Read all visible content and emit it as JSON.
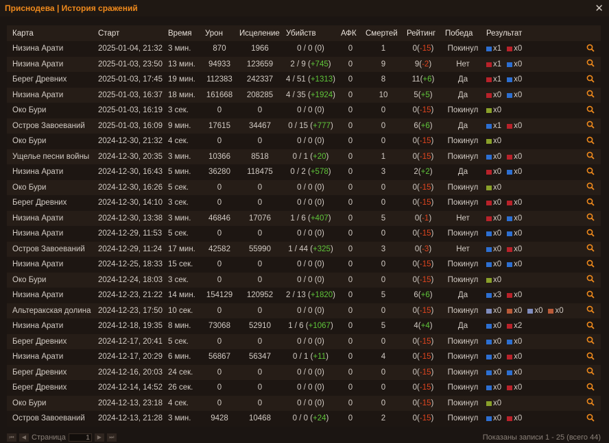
{
  "window": {
    "title": "Приснодева | История сражений"
  },
  "columns": [
    "Карта",
    "Старт",
    "Время",
    "Урон",
    "Исцеление",
    "Убийств",
    "АФК",
    "Смертей",
    "Рейтинг",
    "Победа",
    "Результат"
  ],
  "rows": [
    {
      "map": "Низина Арати",
      "start": "2025-01-04, 21:32",
      "time": "3 мин.",
      "damage": "870",
      "heal": "1966",
      "kills": "0 / 0",
      "kills_delta": "0",
      "kills_sign": "zero",
      "afk": "0",
      "deaths": "1",
      "rating": "0",
      "rating_delta": "-15",
      "rating_sign": "loss",
      "win": "Покинул",
      "result": [
        {
          "flag": "a",
          "text": "x1"
        },
        {
          "flag": "h",
          "text": "x0"
        }
      ]
    },
    {
      "map": "Низина Арати",
      "start": "2025-01-03, 23:50",
      "time": "13 мин.",
      "damage": "94933",
      "heal": "123659",
      "kills": "2 / 9",
      "kills_delta": "+745",
      "kills_sign": "gain",
      "afk": "0",
      "deaths": "9",
      "rating": "9",
      "rating_delta": "-2",
      "rating_sign": "loss",
      "win": "Нет",
      "result": [
        {
          "flag": "h",
          "text": "x1"
        },
        {
          "flag": "a",
          "text": "x0"
        }
      ]
    },
    {
      "map": "Берег Древних",
      "start": "2025-01-03, 17:45",
      "time": "19 мин.",
      "damage": "112383",
      "heal": "242337",
      "kills": "4 / 51",
      "kills_delta": "+1313",
      "kills_sign": "gain",
      "afk": "0",
      "deaths": "8",
      "rating": "11",
      "rating_delta": "+6",
      "rating_sign": "gain",
      "win": "Да",
      "result": [
        {
          "flag": "h",
          "text": "x1"
        },
        {
          "flag": "a",
          "text": "x0"
        }
      ]
    },
    {
      "map": "Низина Арати",
      "start": "2025-01-03, 16:37",
      "time": "18 мин.",
      "damage": "161668",
      "heal": "208285",
      "kills": "4 / 35",
      "kills_delta": "+1924",
      "kills_sign": "gain",
      "afk": "0",
      "deaths": "10",
      "rating": "5",
      "rating_delta": "+5",
      "rating_sign": "gain",
      "win": "Да",
      "result": [
        {
          "flag": "h",
          "text": "x0"
        },
        {
          "flag": "a",
          "text": "x0"
        }
      ]
    },
    {
      "map": "Око Бури",
      "start": "2025-01-03, 16:19",
      "time": "3 сек.",
      "damage": "0",
      "heal": "0",
      "kills": "0 / 0",
      "kills_delta": "0",
      "kills_sign": "zero",
      "afk": "0",
      "deaths": "0",
      "rating": "0",
      "rating_delta": "-15",
      "rating_sign": "loss",
      "win": "Покинул",
      "result": [
        {
          "flag": "g",
          "text": "x0"
        }
      ]
    },
    {
      "map": "Остров Завоеваний",
      "start": "2025-01-03, 16:09",
      "time": "9 мин.",
      "damage": "17615",
      "heal": "34467",
      "kills": "0 / 15",
      "kills_delta": "+777",
      "kills_sign": "gain",
      "afk": "0",
      "deaths": "0",
      "rating": "6",
      "rating_delta": "+6",
      "rating_sign": "gain",
      "win": "Да",
      "result": [
        {
          "flag": "a",
          "text": "x1"
        },
        {
          "flag": "h",
          "text": "x0"
        }
      ]
    },
    {
      "map": "Око Бури",
      "start": "2024-12-30, 21:32",
      "time": "4 сек.",
      "damage": "0",
      "heal": "0",
      "kills": "0 / 0",
      "kills_delta": "0",
      "kills_sign": "zero",
      "afk": "0",
      "deaths": "0",
      "rating": "0",
      "rating_delta": "-15",
      "rating_sign": "loss",
      "win": "Покинул",
      "result": [
        {
          "flag": "g",
          "text": "x0"
        }
      ]
    },
    {
      "map": "Ущелье песни войны",
      "start": "2024-12-30, 20:35",
      "time": "3 мин.",
      "damage": "10366",
      "heal": "8518",
      "kills": "0 / 1",
      "kills_delta": "+20",
      "kills_sign": "gain",
      "afk": "0",
      "deaths": "1",
      "rating": "0",
      "rating_delta": "-15",
      "rating_sign": "loss",
      "win": "Покинул",
      "result": [
        {
          "flag": "a",
          "text": "x0"
        },
        {
          "flag": "h",
          "text": "x0"
        }
      ]
    },
    {
      "map": "Низина Арати",
      "start": "2024-12-30, 16:43",
      "time": "5 мин.",
      "damage": "36280",
      "heal": "118475",
      "kills": "0 / 2",
      "kills_delta": "+578",
      "kills_sign": "gain",
      "afk": "0",
      "deaths": "3",
      "rating": "2",
      "rating_delta": "+2",
      "rating_sign": "gain",
      "win": "Да",
      "result": [
        {
          "flag": "h",
          "text": "x0"
        },
        {
          "flag": "a",
          "text": "x0"
        }
      ]
    },
    {
      "map": "Око Бури",
      "start": "2024-12-30, 16:26",
      "time": "5 сек.",
      "damage": "0",
      "heal": "0",
      "kills": "0 / 0",
      "kills_delta": "0",
      "kills_sign": "zero",
      "afk": "0",
      "deaths": "0",
      "rating": "0",
      "rating_delta": "-15",
      "rating_sign": "loss",
      "win": "Покинул",
      "result": [
        {
          "flag": "g",
          "text": "x0"
        }
      ]
    },
    {
      "map": "Берег Древних",
      "start": "2024-12-30, 14:10",
      "time": "3 сек.",
      "damage": "0",
      "heal": "0",
      "kills": "0 / 0",
      "kills_delta": "0",
      "kills_sign": "zero",
      "afk": "0",
      "deaths": "0",
      "rating": "0",
      "rating_delta": "-15",
      "rating_sign": "loss",
      "win": "Покинул",
      "result": [
        {
          "flag": "h",
          "text": "x0"
        },
        {
          "flag": "h",
          "text": "x0"
        }
      ]
    },
    {
      "map": "Низина Арати",
      "start": "2024-12-30, 13:38",
      "time": "3 мин.",
      "damage": "46846",
      "heal": "17076",
      "kills": "1 / 6",
      "kills_delta": "+407",
      "kills_sign": "gain",
      "afk": "0",
      "deaths": "5",
      "rating": "0",
      "rating_delta": "-1",
      "rating_sign": "loss",
      "win": "Нет",
      "result": [
        {
          "flag": "h",
          "text": "x0"
        },
        {
          "flag": "a",
          "text": "x0"
        }
      ]
    },
    {
      "map": "Низина Арати",
      "start": "2024-12-29, 11:53",
      "time": "5 сек.",
      "damage": "0",
      "heal": "0",
      "kills": "0 / 0",
      "kills_delta": "0",
      "kills_sign": "zero",
      "afk": "0",
      "deaths": "0",
      "rating": "0",
      "rating_delta": "-15",
      "rating_sign": "loss",
      "win": "Покинул",
      "result": [
        {
          "flag": "a",
          "text": "x0"
        },
        {
          "flag": "a",
          "text": "x0"
        }
      ]
    },
    {
      "map": "Остров Завоеваний",
      "start": "2024-12-29, 11:24",
      "time": "17 мин.",
      "damage": "42582",
      "heal": "55990",
      "kills": "1 / 44",
      "kills_delta": "+325",
      "kills_sign": "gain",
      "afk": "0",
      "deaths": "3",
      "rating": "0",
      "rating_delta": "-3",
      "rating_sign": "loss",
      "win": "Нет",
      "result": [
        {
          "flag": "a",
          "text": "x0"
        },
        {
          "flag": "h",
          "text": "x0"
        }
      ]
    },
    {
      "map": "Низина Арати",
      "start": "2024-12-25, 18:33",
      "time": "15 сек.",
      "damage": "0",
      "heal": "0",
      "kills": "0 / 0",
      "kills_delta": "0",
      "kills_sign": "zero",
      "afk": "0",
      "deaths": "0",
      "rating": "0",
      "rating_delta": "-15",
      "rating_sign": "loss",
      "win": "Покинул",
      "result": [
        {
          "flag": "a",
          "text": "x0"
        },
        {
          "flag": "a",
          "text": "x0"
        }
      ]
    },
    {
      "map": "Око Бури",
      "start": "2024-12-24, 18:03",
      "time": "3 сек.",
      "damage": "0",
      "heal": "0",
      "kills": "0 / 0",
      "kills_delta": "0",
      "kills_sign": "zero",
      "afk": "0",
      "deaths": "0",
      "rating": "0",
      "rating_delta": "-15",
      "rating_sign": "loss",
      "win": "Покинул",
      "result": [
        {
          "flag": "g",
          "text": "x0"
        }
      ]
    },
    {
      "map": "Низина Арати",
      "start": "2024-12-23, 21:22",
      "time": "14 мин.",
      "damage": "154129",
      "heal": "120952",
      "kills": "2 / 13",
      "kills_delta": "+1820",
      "kills_sign": "gain",
      "afk": "0",
      "deaths": "5",
      "rating": "6",
      "rating_delta": "+6",
      "rating_sign": "gain",
      "win": "Да",
      "result": [
        {
          "flag": "a",
          "text": "x3"
        },
        {
          "flag": "h",
          "text": "x0"
        }
      ]
    },
    {
      "map": "Альтеракская долина",
      "start": "2024-12-23, 17:50",
      "time": "10 сек.",
      "damage": "0",
      "heal": "0",
      "kills": "0 / 0",
      "kills_delta": "0",
      "kills_sign": "zero",
      "afk": "0",
      "deaths": "0",
      "rating": "0",
      "rating_delta": "-15",
      "rating_sign": "loss",
      "win": "Покинул",
      "result": [
        {
          "flag": "s",
          "text": "x0"
        },
        {
          "flag": "r",
          "text": "x0"
        },
        {
          "flag": "s",
          "text": "x0"
        },
        {
          "flag": "r",
          "text": "x0"
        }
      ]
    },
    {
      "map": "Низина Арати",
      "start": "2024-12-18, 19:35",
      "time": "8 мин.",
      "damage": "73068",
      "heal": "52910",
      "kills": "1 / 6",
      "kills_delta": "+1067",
      "kills_sign": "gain",
      "afk": "0",
      "deaths": "5",
      "rating": "4",
      "rating_delta": "+4",
      "rating_sign": "gain",
      "win": "Да",
      "result": [
        {
          "flag": "a",
          "text": "x0"
        },
        {
          "flag": "h",
          "text": "x2"
        }
      ]
    },
    {
      "map": "Берег Древних",
      "start": "2024-12-17, 20:41",
      "time": "5 сек.",
      "damage": "0",
      "heal": "0",
      "kills": "0 / 0",
      "kills_delta": "0",
      "kills_sign": "zero",
      "afk": "0",
      "deaths": "0",
      "rating": "0",
      "rating_delta": "-15",
      "rating_sign": "loss",
      "win": "Покинул",
      "result": [
        {
          "flag": "a",
          "text": "x0"
        },
        {
          "flag": "a",
          "text": "x0"
        }
      ]
    },
    {
      "map": "Низина Арати",
      "start": "2024-12-17, 20:29",
      "time": "6 мин.",
      "damage": "56867",
      "heal": "56347",
      "kills": "0 / 1",
      "kills_delta": "+11",
      "kills_sign": "gain",
      "afk": "0",
      "deaths": "4",
      "rating": "0",
      "rating_delta": "-15",
      "rating_sign": "loss",
      "win": "Покинул",
      "result": [
        {
          "flag": "a",
          "text": "x0"
        },
        {
          "flag": "h",
          "text": "x0"
        }
      ]
    },
    {
      "map": "Берег Древних",
      "start": "2024-12-16, 20:03",
      "time": "24 сек.",
      "damage": "0",
      "heal": "0",
      "kills": "0 / 0",
      "kills_delta": "0",
      "kills_sign": "zero",
      "afk": "0",
      "deaths": "0",
      "rating": "0",
      "rating_delta": "-15",
      "rating_sign": "loss",
      "win": "Покинул",
      "result": [
        {
          "flag": "a",
          "text": "x0"
        },
        {
          "flag": "a",
          "text": "x0"
        }
      ]
    },
    {
      "map": "Берег Древних",
      "start": "2024-12-14, 14:52",
      "time": "26 сек.",
      "damage": "0",
      "heal": "0",
      "kills": "0 / 0",
      "kills_delta": "0",
      "kills_sign": "zero",
      "afk": "0",
      "deaths": "0",
      "rating": "0",
      "rating_delta": "-15",
      "rating_sign": "loss",
      "win": "Покинул",
      "result": [
        {
          "flag": "a",
          "text": "x0"
        },
        {
          "flag": "h",
          "text": "x0"
        }
      ]
    },
    {
      "map": "Око Бури",
      "start": "2024-12-13, 23:18",
      "time": "4 сек.",
      "damage": "0",
      "heal": "0",
      "kills": "0 / 0",
      "kills_delta": "0",
      "kills_sign": "zero",
      "afk": "0",
      "deaths": "0",
      "rating": "0",
      "rating_delta": "-15",
      "rating_sign": "loss",
      "win": "Покинул",
      "result": [
        {
          "flag": "g",
          "text": "x0"
        }
      ]
    },
    {
      "map": "Остров Завоеваний",
      "start": "2024-12-13, 21:28",
      "time": "3 мин.",
      "damage": "9428",
      "heal": "10468",
      "kills": "0 / 0",
      "kills_delta": "+24",
      "kills_sign": "gain",
      "afk": "0",
      "deaths": "2",
      "rating": "0",
      "rating_delta": "-15",
      "rating_sign": "loss",
      "win": "Покинул",
      "result": [
        {
          "flag": "a",
          "text": "x0"
        },
        {
          "flag": "h",
          "text": "x0"
        }
      ]
    }
  ],
  "icons": {
    "details": "magnifier-icon",
    "close": "close-icon"
  },
  "colors": {
    "accent": "#f08a1c",
    "gain": "#5fc53a",
    "loss": "#e0451f",
    "alliance_flag": "#2d6fd1",
    "horde_flag": "#b8222a",
    "neutral_flag": "#8aa02a"
  },
  "footer": {
    "page_label": "Страница",
    "page_value": "1",
    "records": "Показаны записи 1 - 25 (всего 44)"
  }
}
